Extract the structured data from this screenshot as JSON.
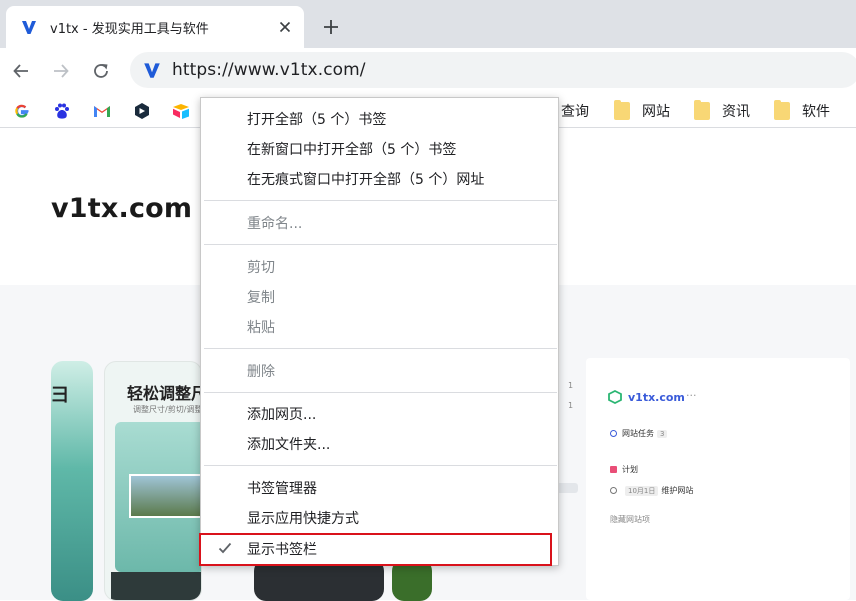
{
  "tab": {
    "title": "v1tx - 发现实用工具与软件",
    "favicon": "v1tx-logo-icon",
    "close": "close-icon"
  },
  "new_tab": "plus-icon",
  "toolbar": {
    "back": "arrow-left-icon",
    "forward": "arrow-right-icon",
    "reload": "reload-icon",
    "url": "https://www.v1tx.com/"
  },
  "bookmarks": {
    "icons": [
      "google-icon",
      "baidu-icon",
      "gmail-icon",
      "bookmark-app-icon",
      "airtable-icon"
    ],
    "visible_partial": "查询",
    "folders": [
      {
        "label": "网站"
      },
      {
        "label": "资讯"
      },
      {
        "label": "软件"
      }
    ]
  },
  "page": {
    "site_title": "v1tx.com",
    "promo_left": "轻松调整尺",
    "promo_sub": "调整尺寸/剪切/调整位",
    "app_name": "v1tx.com",
    "app_dots": "···",
    "app_rows": [
      {
        "label": "网站任务",
        "tag": "3"
      },
      {
        "label": "计划",
        "tag": ""
      },
      {
        "label": "维护网站",
        "tag": "10月1日"
      },
      {
        "label": "隐藏网站项",
        "tag": ""
      }
    ],
    "mid_numbers": [
      "1",
      "1"
    ]
  },
  "context_menu": {
    "groups": [
      [
        "打开全部（5 个）书签",
        "在新窗口中打开全部（5 个）书签",
        "在无痕式窗口中打开全部（5 个）网址"
      ],
      [
        "重命名..."
      ],
      [
        "剪切",
        "复制",
        "粘贴"
      ],
      [
        "删除"
      ],
      [
        "添加网页...",
        "添加文件夹..."
      ],
      [
        "书签管理器",
        "显示应用快捷方式",
        "显示书签栏"
      ]
    ],
    "checked_item": "显示书签栏",
    "highlight_color": "#d9121b"
  },
  "colors": {
    "tabstrip": "#dee1e6",
    "omnibox": "#f1f3f4",
    "brand_blue": "#1f5bd8"
  }
}
